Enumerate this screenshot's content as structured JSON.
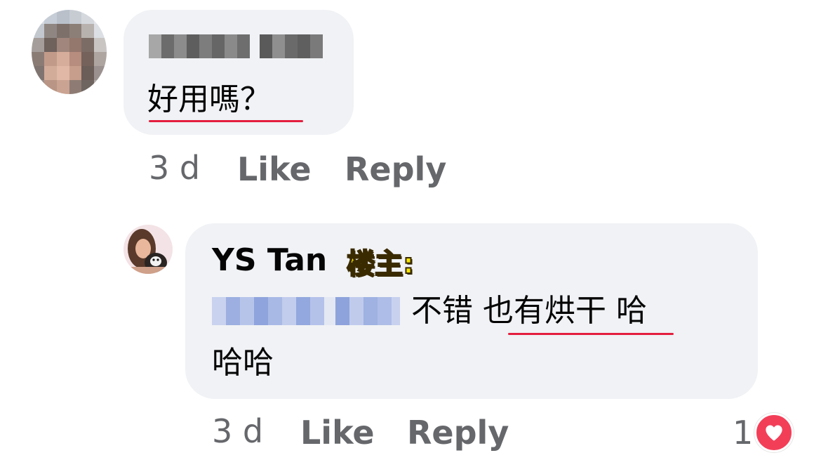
{
  "comments": [
    {
      "text": "好用嗎？",
      "time": "3 d",
      "like_label": "Like",
      "reply_label": "Reply"
    },
    {
      "author": "YS Tan",
      "op_label": "楼主:",
      "text_line1": "不错 也有烘干 哈",
      "text_line2": "哈哈",
      "time": "3 d",
      "like_label": "Like",
      "reply_label": "Reply",
      "reaction_count": "1",
      "reaction_icon": "heart-icon"
    }
  ],
  "colors": {
    "bubble": "#f0f2f5",
    "meta_text": "#65676b",
    "heart": "#f33e58",
    "underline": "#e41e3f"
  }
}
